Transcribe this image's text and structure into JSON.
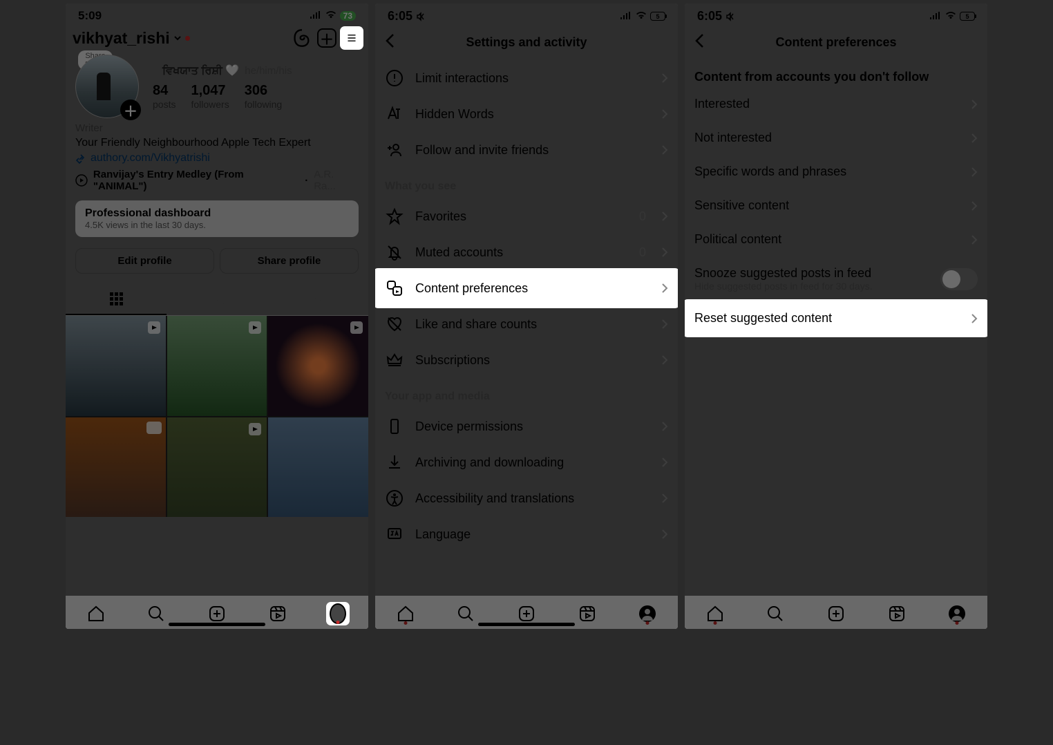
{
  "screen1": {
    "time": "5:09",
    "battery": "73",
    "username": "vikhyat_rishi",
    "display_name": "ਵਿਖਯਾਤ ਰਿਸ਼ੀ 🤍",
    "pronouns": "he/him/his",
    "note": "Share a note",
    "stats": {
      "posts_n": "84",
      "posts_l": "posts",
      "followers_n": "1,047",
      "followers_l": "followers",
      "following_n": "306",
      "following_l": "following"
    },
    "job": "Writer",
    "bio": "Your Friendly Neighbourhood Apple Tech Expert",
    "link": "authory.com/Vikhyatrishi",
    "music_title": "Ranvijay's Entry Medley (From \"ANIMAL\")",
    "music_artist": "A.R. Ra...",
    "dashboard_title": "Professional dashboard",
    "dashboard_sub": "4.5K views in the last 30 days.",
    "edit_btn": "Edit profile",
    "share_btn": "Share profile"
  },
  "screen2": {
    "time": "6:05",
    "bat": "5",
    "title": "Settings and activity",
    "items": {
      "limit": "Limit interactions",
      "hidden": "Hidden Words",
      "follow": "Follow and invite friends",
      "sec_what": "What you see",
      "fav": "Favorites",
      "fav_n": "0",
      "muted": "Muted accounts",
      "muted_n": "0",
      "content_pref": "Content preferences",
      "like_share": "Like and share counts",
      "subs": "Subscriptions",
      "sec_app": "Your app and media",
      "device": "Device permissions",
      "archive": "Archiving and downloading",
      "access": "Accessibility and translations",
      "lang": "Language"
    }
  },
  "screen3": {
    "time": "6:05",
    "bat": "5",
    "title": "Content preferences",
    "group": "Content from accounts you don't follow",
    "items": {
      "interested": "Interested",
      "not_interested": "Not interested",
      "words": "Specific words and phrases",
      "sensitive": "Sensitive content",
      "political": "Political content",
      "snooze": "Snooze suggested posts in feed",
      "snooze_sub": "Hide suggested posts in feed for 30 days.",
      "reset": "Reset suggested content"
    }
  }
}
